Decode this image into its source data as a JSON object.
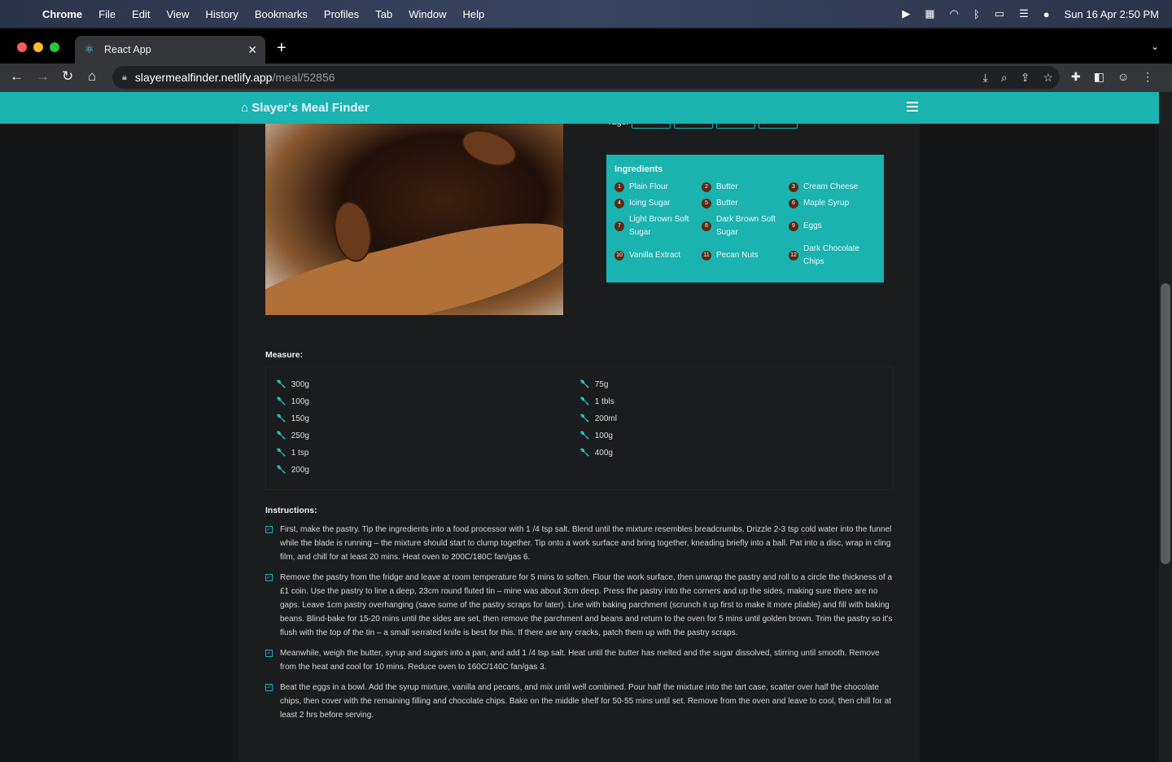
{
  "menubar": {
    "app": "Chrome",
    "items": [
      "File",
      "Edit",
      "View",
      "History",
      "Bookmarks",
      "Profiles",
      "Tab",
      "Window",
      "Help"
    ],
    "datetime": "Sun 16 Apr  2:50 PM"
  },
  "browser": {
    "tab_title": "React App",
    "url_host": "slayermealfinder.netlify.app",
    "url_path": "/meal/52856"
  },
  "app": {
    "brand": "Slayer's Meal Finder"
  },
  "meal": {
    "tags_label": "Tags:",
    "ingredients_title": "Ingredients",
    "ingredients": [
      {
        "n": "1",
        "name": "Plain Flour"
      },
      {
        "n": "2",
        "name": "Butter"
      },
      {
        "n": "3",
        "name": "Cream Cheese"
      },
      {
        "n": "4",
        "name": "Icing Sugar"
      },
      {
        "n": "5",
        "name": "Butter"
      },
      {
        "n": "6",
        "name": "Maple Syrup"
      },
      {
        "n": "7",
        "name": "Light Brown Soft Sugar"
      },
      {
        "n": "8",
        "name": "Dark Brown Soft Sugar"
      },
      {
        "n": "9",
        "name": "Eggs"
      },
      {
        "n": "10",
        "name": "Vanilla Extract"
      },
      {
        "n": "11",
        "name": "Pecan Nuts"
      },
      {
        "n": "12",
        "name": "Dark Chocolate Chips"
      }
    ],
    "measure_label": "Measure:",
    "measures_left": [
      "300g",
      "100g",
      "150g",
      "250g",
      "1 tsp",
      "200g"
    ],
    "measures_right": [
      "75g",
      "1 tbls",
      "200ml",
      "100g",
      "400g"
    ],
    "instructions_label": "Instructions:",
    "instructions": [
      "First, make the pastry. Tip the ingredients into a food processor with 1 /4 tsp salt. Blend until the mixture resembles breadcrumbs. Drizzle 2-3 tsp cold water into the funnel while the blade is running – the mixture should start to clump together. Tip onto a work surface and bring together, kneading briefly into a ball. Pat into a disc, wrap in cling film, and chill for at least 20 mins. Heat oven to 200C/180C fan/gas 6.",
      "Remove the pastry from the fridge and leave at room temperature for 5 mins to soften. Flour the work surface, then unwrap the pastry and roll to a circle the thickness of a £1 coin. Use the pastry to line a deep, 23cm round fluted tin – mine was about 3cm deep. Press the pastry into the corners and up the sides, making sure there are no gaps. Leave 1cm pastry overhanging (save some of the pastry scraps for later). Line with baking parchment (scrunch it up first to make it more pliable) and fill with baking beans. Blind-bake for 15-20 mins until the sides are set, then remove the parchment and beans and return to the oven for 5 mins until golden brown. Trim the pastry so it's flush with the top of the tin – a small serrated knife is best for this. If there are any cracks, patch them up with the pastry scraps.",
      "Meanwhile, weigh the butter, syrup and sugars into a pan, and add 1 /4 tsp salt. Heat until the butter has melted and the sugar dissolved, stirring until smooth. Remove from the heat and cool for 10 mins. Reduce oven to 160C/140C fan/gas 3.",
      "Beat the eggs in a bowl. Add the syrup mixture, vanilla and pecans, and mix until well combined. Pour half the mixture into the tart case, scatter over half the chocolate chips, then cover with the remaining filling and chocolate chips. Bake on the middle shelf for 50-55 mins until set. Remove from the oven and leave to cool, then chill for at least 2 hrs before serving."
    ]
  },
  "colors": {
    "accent": "#1ab3b0",
    "badge": "#5a2a14",
    "background": "#1b1c1e"
  }
}
